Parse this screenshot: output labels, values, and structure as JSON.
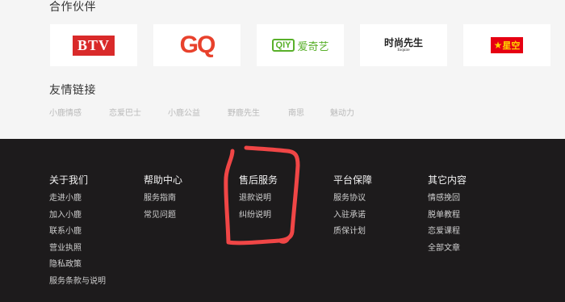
{
  "partners": {
    "title": "合作伙伴",
    "logos": [
      {
        "text": "BTV",
        "color": "#d92a2a"
      },
      {
        "text": "GQ",
        "color": "#e8412c"
      },
      {
        "badge": "QIY",
        "text": "爱奇艺",
        "color": "#59b02a"
      },
      {
        "text": "时尚先生",
        "subtext": "Esquire",
        "color": "#222222"
      },
      {
        "text": "星空",
        "color": "#e60012"
      }
    ]
  },
  "links": {
    "title": "友情链接",
    "items": [
      "小鹿情感",
      "恋爱巴士",
      "小鹿公益",
      "野鹿先生",
      "南思",
      "魅动力"
    ]
  },
  "footer": {
    "columns": [
      {
        "title": "关于我们",
        "items": [
          "走进小鹿",
          "加入小鹿",
          "联系小鹿",
          "营业执照",
          "隐私政策",
          "服务条款与说明"
        ]
      },
      {
        "title": "帮助中心",
        "items": [
          "服务指南",
          "常见问题"
        ]
      },
      {
        "title": "售后服务",
        "items": [
          "退款说明",
          "纠纷说明"
        ]
      },
      {
        "title": "平台保障",
        "items": [
          "服务协议",
          "入驻承诺",
          "质保计划"
        ]
      },
      {
        "title": "其它内容",
        "items": [
          "情感挽回",
          "脱单教程",
          "恋爱课程",
          "全部文章"
        ]
      }
    ]
  },
  "colors": {
    "annotation": "#f04646",
    "footer_bg": "#1d1b1c",
    "page_bg": "#f5f5f5"
  }
}
